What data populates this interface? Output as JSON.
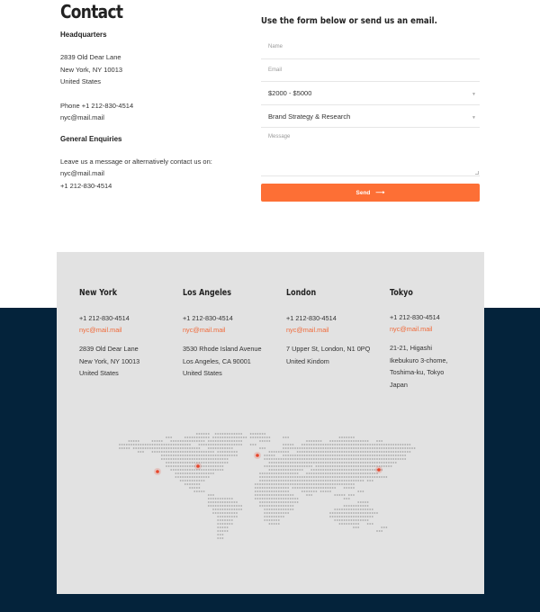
{
  "contact": {
    "title": "Contact",
    "headquarters": {
      "heading": "Headquarters",
      "address": [
        "2839 Old Dear Lane",
        "New York, NY 10013",
        "United States"
      ],
      "phone": "Phone +1 212-830-4514",
      "email": "nyc@mail.mail"
    },
    "general": {
      "heading": "General Enquiries",
      "lines": [
        "Leave us a message or alternatively contact us on:",
        "nyc@mail.mail",
        "+1 212-830-4514"
      ]
    }
  },
  "form": {
    "title": "Use the form below or send us an email.",
    "name_placeholder": "Name",
    "email_placeholder": "Email",
    "budget_value": "$2000 - $5000",
    "service_value": "Brand Strategy & Research",
    "message_placeholder": "Message",
    "send_label": "Send",
    "send_icon": "arrow-right-icon",
    "accent_color": "#fd6f35"
  },
  "offices": [
    {
      "city": "New York",
      "phone": "+1 212-830-4514",
      "email": "nyc@mail.mail",
      "address": [
        "2839 Old Dear Lane",
        "New York, NY 10013",
        "United States"
      ]
    },
    {
      "city": "Los Angeles",
      "phone": "+1 212-830-4514",
      "email": "nyc@mail.mail",
      "address": [
        "3530 Rhode Island Avenue",
        "Los Angeles, CA 90001",
        "United States"
      ]
    },
    {
      "city": "London",
      "phone": "+1 212-830-4514",
      "email": "nyc@mail.mail",
      "address": [
        "7 Upper St, London, N1 0PQ",
        "United Kindom"
      ]
    },
    {
      "city": "Tokyo",
      "phone": "+1 212-830-4514",
      "email": "nyc@mail.mail",
      "address": [
        "21-21, Higashi",
        "Ikebukuro 3-chome,",
        "Toshima-ku, Tokyo",
        "Japan"
      ]
    }
  ],
  "map": {
    "markers": [
      "Los Angeles",
      "New York",
      "London",
      "Tokyo"
    ],
    "marker_color": "#e8452a",
    "dot_color": "#a8a8a8"
  },
  "colors": {
    "navy": "#04233b",
    "card": "#e2e2e2",
    "link": "#f06a3a"
  }
}
